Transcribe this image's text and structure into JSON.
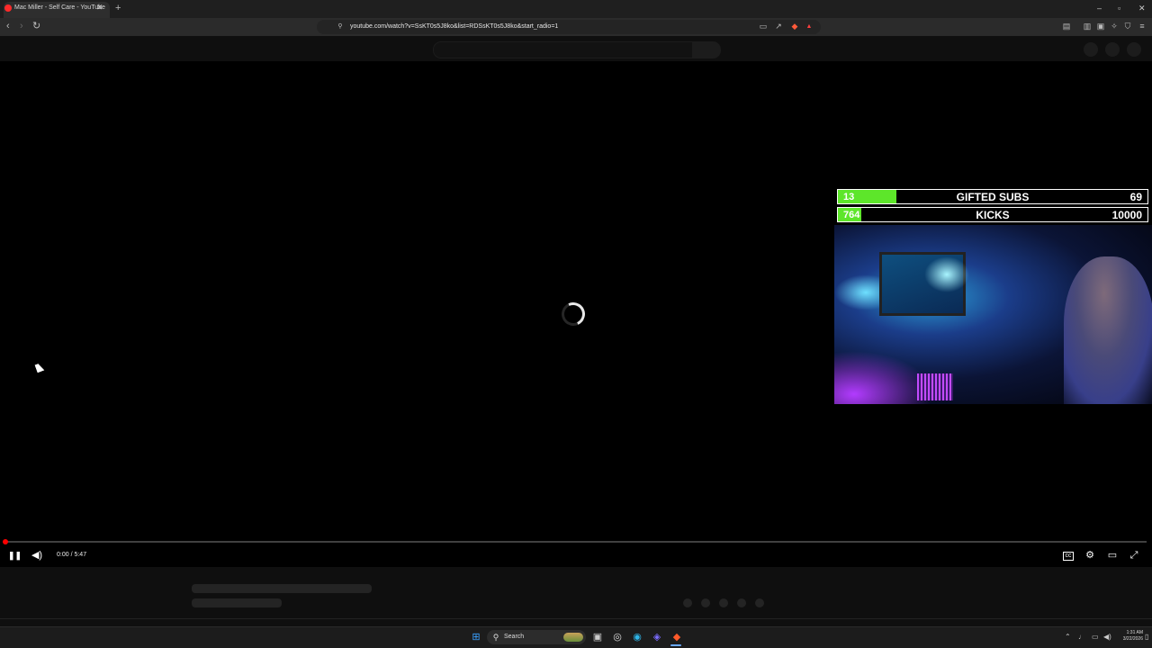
{
  "browser": {
    "tab_title": "Mac Miller - Self Care - YouTube",
    "url": "youtube.com/watch?v=SsKT0s5J8ko&list=RDSsKT0s5J8ko&start_radio=1"
  },
  "player": {
    "time_display": "0:00 / 5:47",
    "progress_fraction": 0.0,
    "state": "loading"
  },
  "overlay": {
    "goals": [
      {
        "current": "13",
        "label": "GIFTED SUBS",
        "target": "69",
        "fill_fraction": 0.188,
        "color": "#5de62a"
      },
      {
        "current": "764",
        "label": "KICKS",
        "target": "10000",
        "fill_fraction": 0.076,
        "color": "#5de62a"
      }
    ]
  },
  "taskbar": {
    "search_label": "Search",
    "time": "1:31 AM",
    "date": "3/22/2026"
  },
  "icons": {
    "back": "←",
    "forward": "→",
    "reload": "↻",
    "bookmark": "bookmark-icon",
    "pause": "❚❚",
    "volume": "🔈",
    "captions": "CC",
    "settings": "⚙",
    "theater": "▭",
    "fullscreen": "⤢"
  }
}
